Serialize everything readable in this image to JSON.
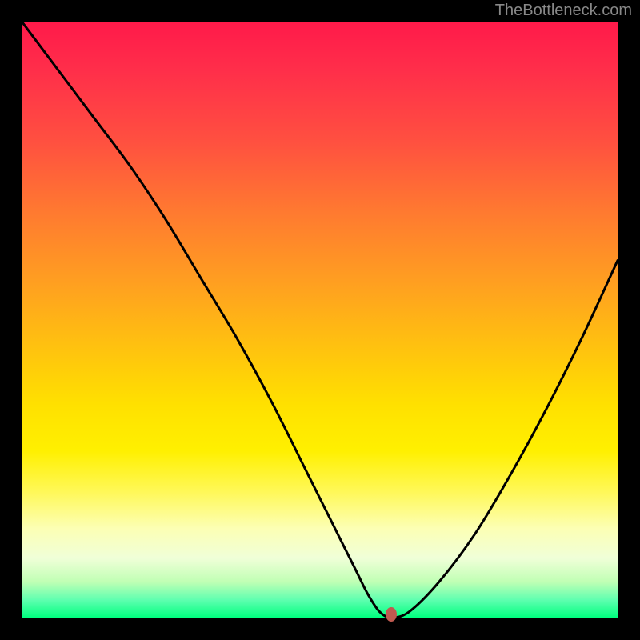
{
  "watermark": "TheBottleneck.com",
  "chart_data": {
    "type": "line",
    "title": "",
    "xlabel": "",
    "ylabel": "",
    "xlim": [
      0,
      100
    ],
    "ylim": [
      0,
      100
    ],
    "x": [
      0,
      6,
      12,
      18,
      24,
      30,
      36,
      42,
      48,
      52,
      56,
      58,
      60,
      62,
      65,
      70,
      76,
      82,
      88,
      94,
      100
    ],
    "values": [
      100,
      92,
      84,
      76,
      67,
      57,
      47,
      36,
      24,
      16,
      8,
      4,
      1,
      0,
      1,
      6,
      14,
      24,
      35,
      47,
      60
    ],
    "marker": {
      "x": 62,
      "y": 0
    },
    "background_gradient": [
      "#ff1a4a",
      "#ffa020",
      "#ffe000",
      "#00ff7f"
    ],
    "background_meaning": "bottleneck severity (red=high, green=optimal)"
  }
}
